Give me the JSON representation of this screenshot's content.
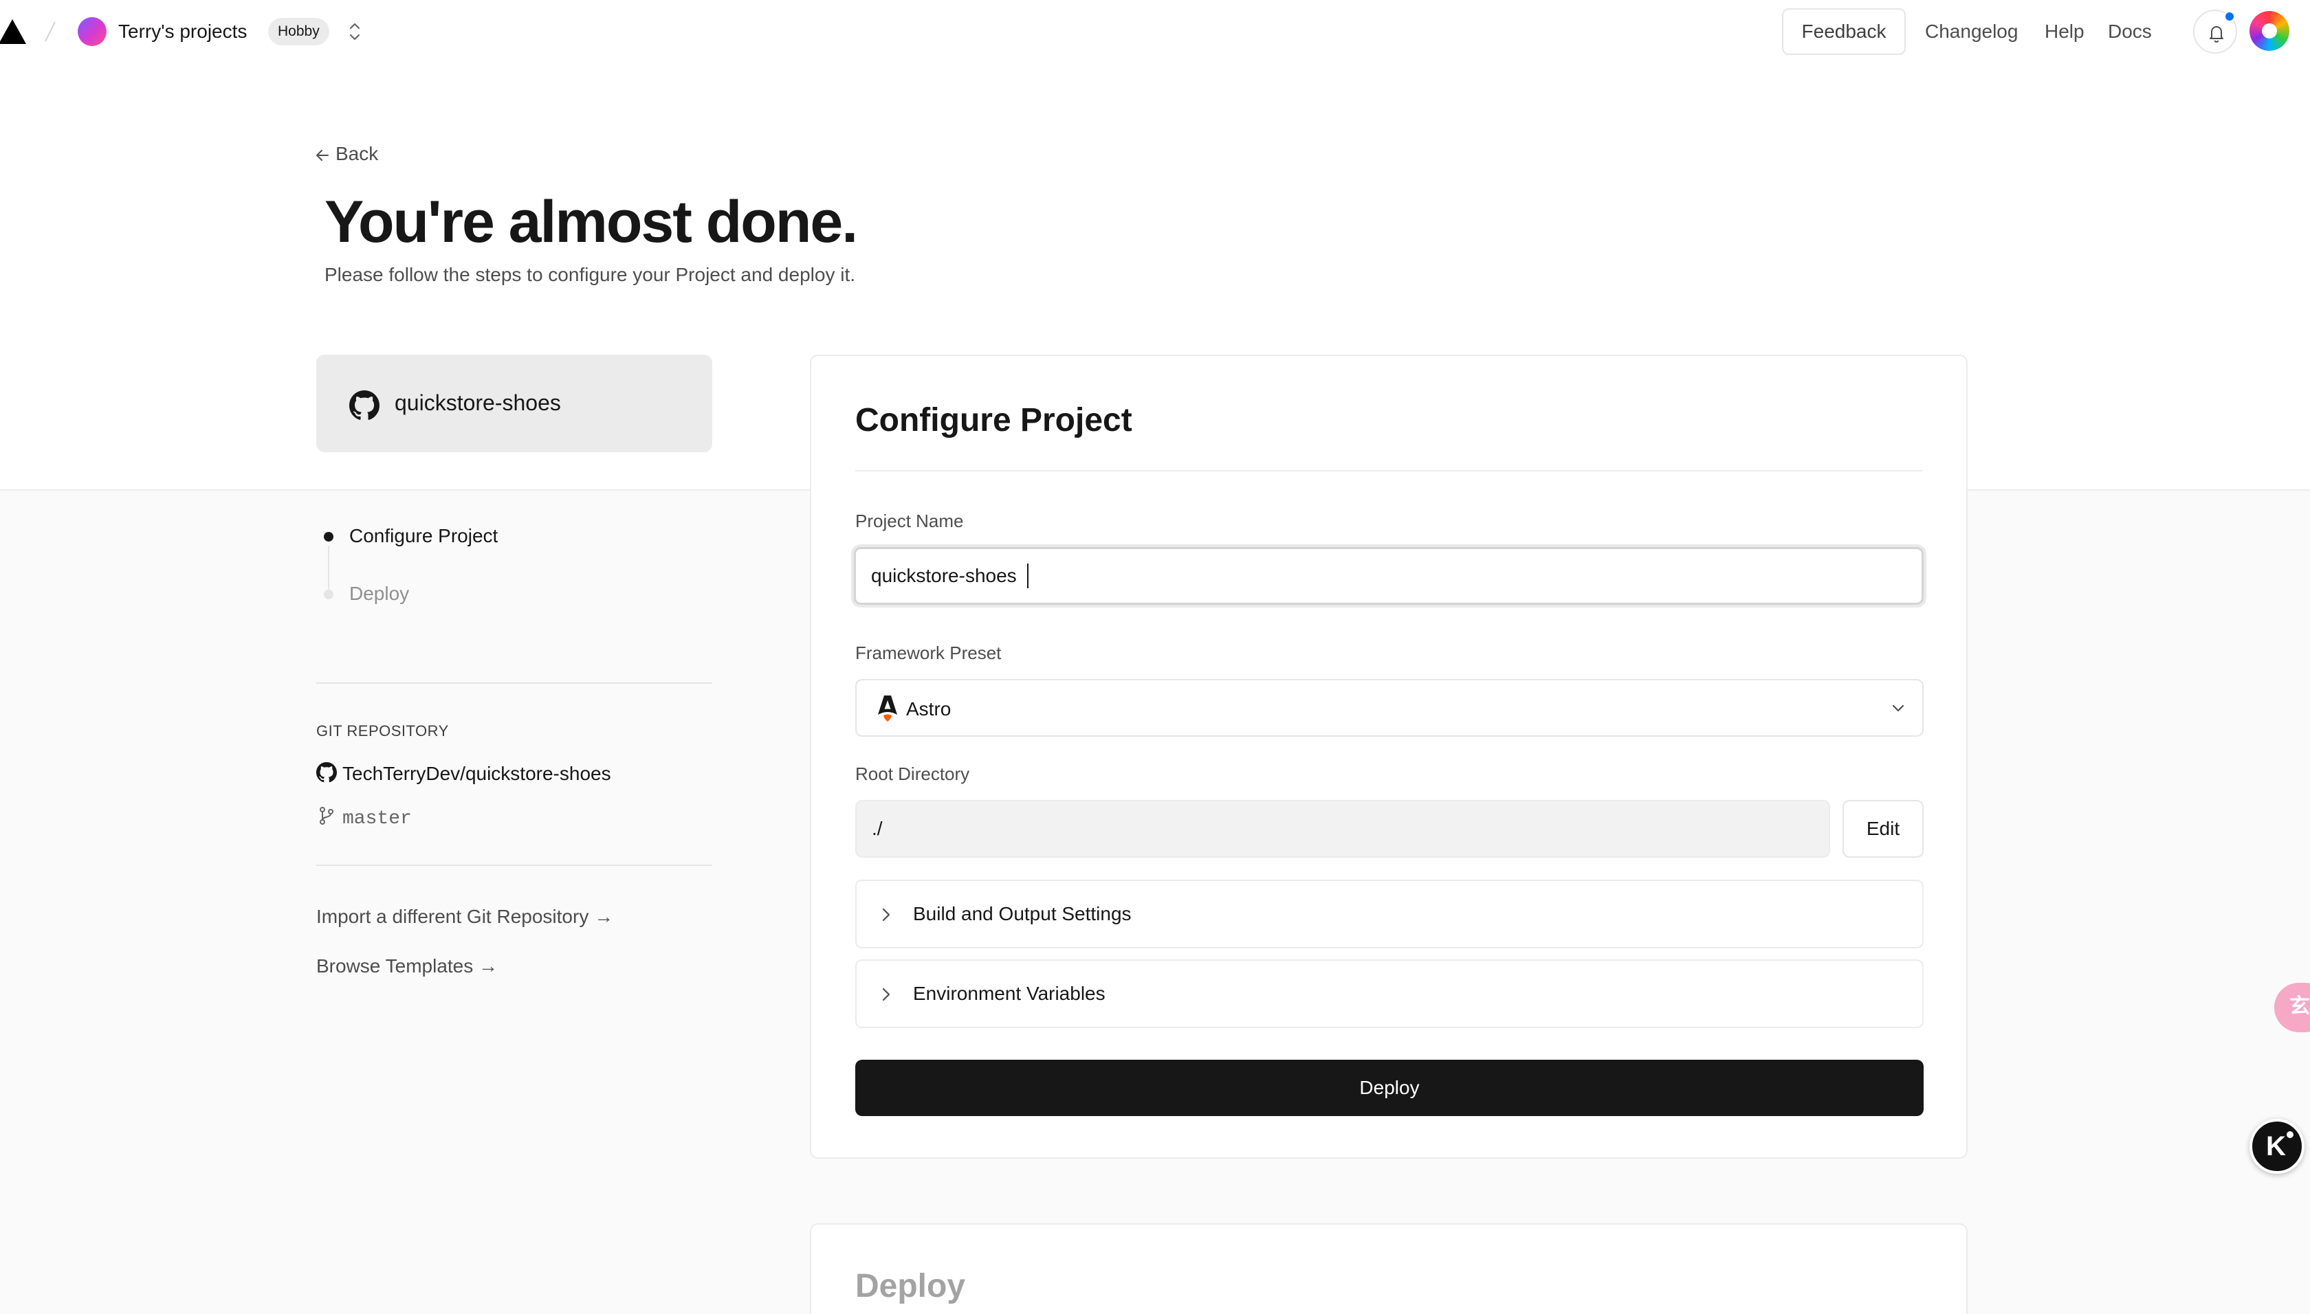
{
  "header": {
    "team_name": "Terry's projects",
    "plan_badge": "Hobby",
    "feedback_label": "Feedback",
    "nav_links": [
      "Changelog",
      "Help",
      "Docs"
    ]
  },
  "page": {
    "back_label": "Back",
    "title": "You're almost done.",
    "subtitle": "Please follow the steps to configure your Project and deploy it."
  },
  "sidebar": {
    "repo_card_name": "quickstore-shoes",
    "steps": [
      {
        "label": "Configure Project",
        "active": true
      },
      {
        "label": "Deploy",
        "active": false
      }
    ],
    "git_heading": "GIT REPOSITORY",
    "git_repo": "TechTerryDev/quickstore-shoes",
    "git_branch": "master",
    "links": [
      "Import a different Git Repository →",
      "Browse Templates →"
    ]
  },
  "configure": {
    "title": "Configure Project",
    "project_name_label": "Project Name",
    "project_name_value": "quickstore-shoes",
    "framework_label": "Framework Preset",
    "framework_value": "Astro",
    "root_dir_label": "Root Directory",
    "root_dir_value": "./",
    "edit_label": "Edit",
    "accordions": [
      "Build and Output Settings",
      "Environment Variables"
    ],
    "deploy_label": "Deploy"
  },
  "deploy_section": {
    "title": "Deploy"
  },
  "floating": {
    "translate_glyph": "玄",
    "k_glyph": "K"
  },
  "colors": {
    "accent_black": "#171717",
    "notification_dot": "#0a72ef",
    "lower_band": "#fafafa"
  }
}
